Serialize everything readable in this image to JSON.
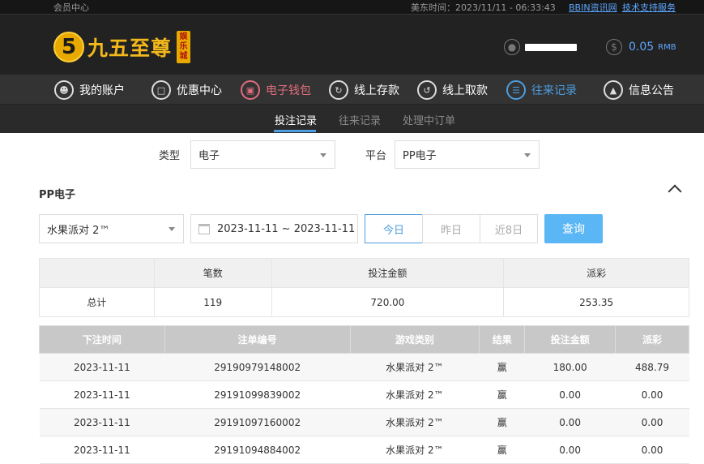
{
  "topbar": {
    "member_center": "会员中心",
    "time_label": "美东时间：2023/11/11 - 06:33:43",
    "link_bbin": "BBIN资讯网",
    "link_support": "技术支持服务"
  },
  "header": {
    "logo_mark": "5",
    "logo_text": "九五至尊",
    "logo_tag": "娱乐城",
    "balance": "0.05",
    "currency": "RMB"
  },
  "nav": {
    "items": [
      {
        "label": "我的账户",
        "icon": "user-icon"
      },
      {
        "label": "优惠中心",
        "icon": "gift-icon"
      },
      {
        "label": "电子钱包",
        "icon": "wallet-icon"
      },
      {
        "label": "线上存款",
        "icon": "deposit-icon"
      },
      {
        "label": "线上取款",
        "icon": "withdraw-icon"
      },
      {
        "label": "往来记录",
        "icon": "records-icon"
      },
      {
        "label": "信息公告",
        "icon": "bell-icon"
      }
    ],
    "active": "往来记录"
  },
  "subnav": {
    "tabs": [
      "投注记录",
      "往来记录",
      "处理中订单"
    ],
    "active": "投注记录"
  },
  "filters": {
    "type_label": "类型",
    "type_value": "电子",
    "platform_label": "平台",
    "platform_value": "PP电子"
  },
  "section": {
    "title": "PP电子",
    "game_select": "水果派对 2™",
    "date_range": "2023-11-11 ~ 2023-11-11",
    "range_buttons": [
      "今日",
      "昨日",
      "近8日"
    ],
    "active_range": "今日",
    "query_label": "查询"
  },
  "summary": {
    "headers": [
      "",
      "笔数",
      "投注金额",
      "派彩"
    ],
    "row": [
      "总计",
      "119",
      "720.00",
      "253.35"
    ]
  },
  "details": {
    "headers": [
      "下注时间",
      "注单编号",
      "游戏类别",
      "结果",
      "投注金额",
      "派彩"
    ],
    "rows": [
      [
        "2023-11-11",
        "29190979148002",
        "水果派对 2™",
        "赢",
        "180.00",
        "488.79"
      ],
      [
        "2023-11-11",
        "29191099839002",
        "水果派对 2™",
        "赢",
        "0.00",
        "0.00"
      ],
      [
        "2023-11-11",
        "29191097160002",
        "水果派对 2™",
        "赢",
        "0.00",
        "0.00"
      ],
      [
        "2023-11-11",
        "29191094884002",
        "水果派对 2™",
        "赢",
        "0.00",
        "0.00"
      ]
    ]
  },
  "colors": {
    "accent_blue": "#4d9de0",
    "wallet_pink": "#e06c7d",
    "logo_gold": "#f3b81b",
    "query_button": "#5ab6f4"
  }
}
